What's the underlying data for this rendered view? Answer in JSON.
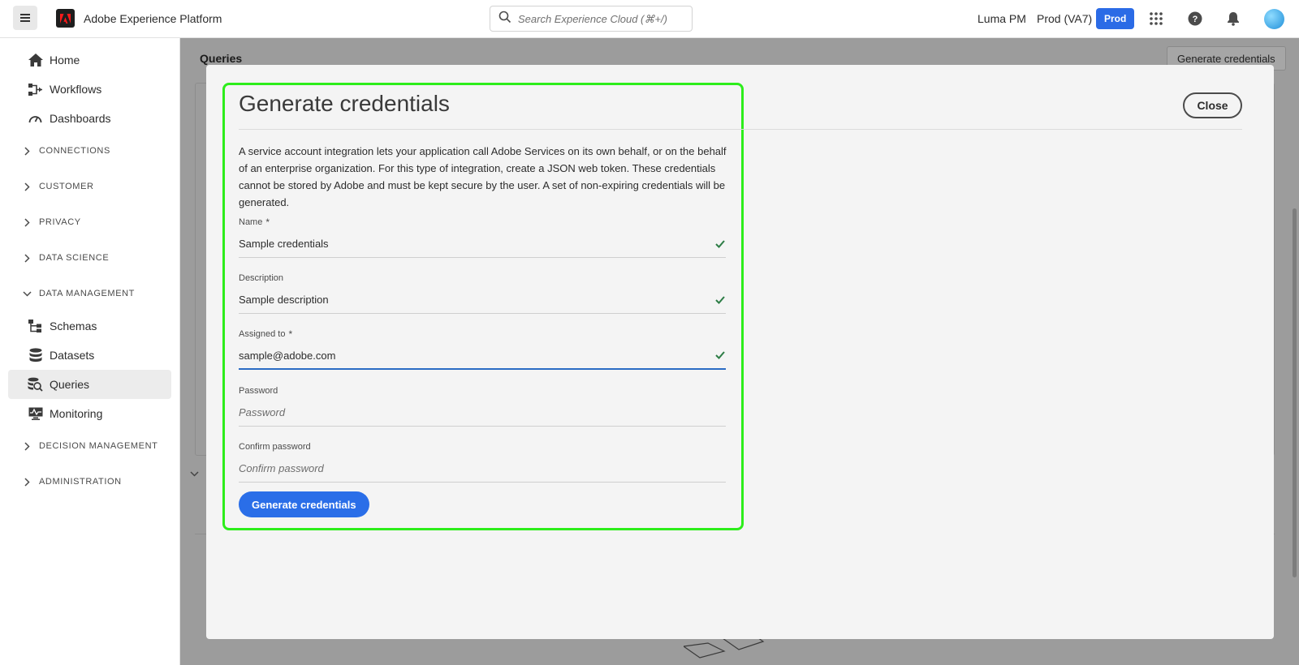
{
  "header": {
    "app_title": "Adobe Experience Platform",
    "search_placeholder": "Search Experience Cloud (⌘+/)",
    "org": "Luma PM",
    "sandbox": "Prod (VA7)",
    "sandbox_badge": "Prod",
    "icons": [
      "menu-icon",
      "adobe-logo",
      "search-icon",
      "apps-icon",
      "help-icon",
      "notifications-icon",
      "avatar"
    ]
  },
  "sidebar": {
    "top_items": [
      {
        "label": "Home",
        "icon": "home-icon"
      },
      {
        "label": "Workflows",
        "icon": "workflows-icon"
      },
      {
        "label": "Dashboards",
        "icon": "dashboards-icon"
      }
    ],
    "groups": {
      "connections": "CONNECTIONS",
      "customer": "CUSTOMER",
      "privacy": "PRIVACY",
      "data_science": "DATA SCIENCE",
      "data_management": "DATA MANAGEMENT",
      "decision_management": "DECISION MANAGEMENT",
      "administration": "ADMINISTRATION"
    },
    "data_management_items": [
      {
        "label": "Schemas",
        "icon": "schemas-icon"
      },
      {
        "label": "Datasets",
        "icon": "datasets-icon"
      },
      {
        "label": "Queries",
        "icon": "queries-icon",
        "active": true
      },
      {
        "label": "Monitoring",
        "icon": "monitoring-icon"
      }
    ]
  },
  "background_page": {
    "title": "Queries",
    "generate_button": "Generate credentials"
  },
  "modal": {
    "title": "Generate credentials",
    "close_label": "Close",
    "description": "A service account integration lets your application call Adobe Services on its own behalf, or on the behalf of an enterprise organization. For this type of integration, create a JSON web token. These credentials cannot be stored by Adobe and must be kept secure by the user. A set of non-expiring credentials will be generated.",
    "fields": {
      "name": {
        "label": "Name",
        "required_mark": "*",
        "value": "Sample credentials",
        "valid": true
      },
      "description": {
        "label": "Description",
        "value": "Sample description",
        "valid": true
      },
      "assigned_to": {
        "label": "Assigned to",
        "required_mark": "*",
        "value": "sample@adobe.com",
        "valid": true
      },
      "password": {
        "label": "Password",
        "placeholder": "Password",
        "value": ""
      },
      "confirm_password": {
        "label": "Confirm password",
        "placeholder": "Confirm password",
        "value": ""
      }
    },
    "submit_label": "Generate credentials",
    "colors": {
      "accent": "#2a6ee8",
      "check": "#2d7d46",
      "highlight": "#2ded1b"
    }
  }
}
